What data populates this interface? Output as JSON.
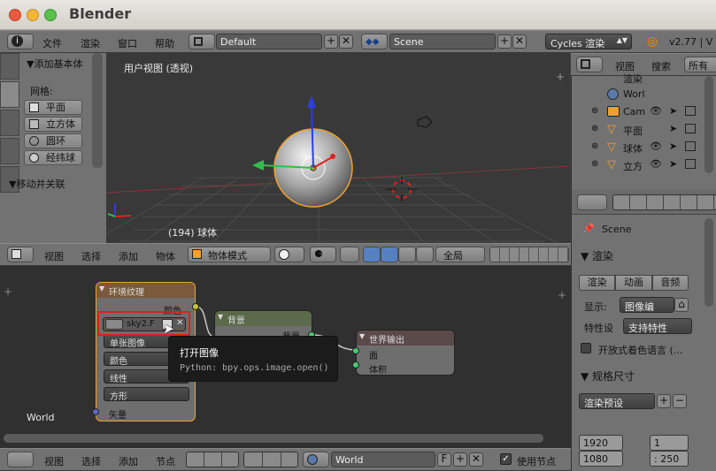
{
  "window": {
    "title": "Blender"
  },
  "info_header": {
    "menus": [
      "文件",
      "渲染",
      "窗口",
      "帮助"
    ],
    "layout": "Default",
    "scene": "Scene",
    "engine": "Cycles 渲染",
    "version": "v2.77 | V"
  },
  "outliner_header": {
    "view": "视图",
    "search": "搜索",
    "filter": "所有"
  },
  "tool_panel": {
    "add_primitive": "▼添加基本体",
    "mesh_label": "网格:",
    "buttons": [
      "平面",
      "立方体",
      "圆环",
      "经纬球"
    ],
    "move_section": "▼移动并关联"
  },
  "viewport": {
    "label": "用户视图 (透视)",
    "status": "(194) 球体"
  },
  "viewport_header": {
    "menus": [
      "视图",
      "选择",
      "添加",
      "物体"
    ],
    "mode": "物体模式",
    "orientation": "全局"
  },
  "outliner": {
    "rows": [
      {
        "label": "渲染"
      },
      {
        "label": "Worl"
      },
      {
        "label": "Cam"
      },
      {
        "label": "平面"
      },
      {
        "label": "球体"
      },
      {
        "label": "立方"
      }
    ]
  },
  "properties": {
    "scene": "Scene",
    "render_section": "▼ 渲染",
    "tabs": [
      "渲染",
      "动画",
      "音频"
    ],
    "display_label": "显示:",
    "display_value": "图像编",
    "feature_label": "特性设",
    "feature_value": "支持特性",
    "osl_label": "开放式着色语言 (...",
    "dimensions_section": "▼ 规格尺寸",
    "preset": "渲染预设",
    "res_x": "1920",
    "res_y": "1080",
    "aspect_x": "1",
    "aspect_y": ": 250"
  },
  "nodes": {
    "env_texture": {
      "title": "环境纹理",
      "out_color": "颜色",
      "image_name": "sky2.",
      "image_f": "F",
      "projection": "单张图像",
      "color_mode": "颜色",
      "interp": "线性",
      "mapping": "方形",
      "vector": "矢量"
    },
    "background": {
      "title": "背景",
      "out": "背景"
    },
    "world_output": {
      "title": "世界输出",
      "surface": "面",
      "volume": "体积"
    },
    "world_label": "World"
  },
  "tooltip": {
    "title": "打开图像",
    "python": "Python: bpy.ops.image.open()"
  },
  "node_header": {
    "menus": [
      "视图",
      "选择",
      "添加",
      "节点"
    ],
    "world": "World",
    "f": "F",
    "use_nodes": "使用节点"
  },
  "colors": {
    "accent_orange": "#f0a030",
    "selection_red": "#e21d1d",
    "header_gray": "#727272"
  }
}
